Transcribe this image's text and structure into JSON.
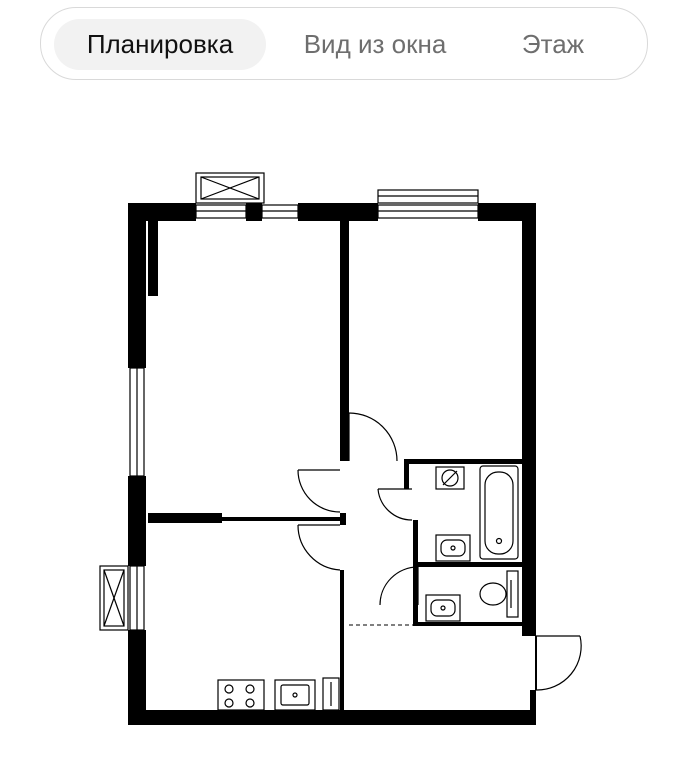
{
  "tabs": [
    {
      "label": "Планировка",
      "active": true
    },
    {
      "label": "Вид из окна",
      "active": false
    },
    {
      "label": "Этаж",
      "active": false
    }
  ],
  "colors": {
    "active_tab_bg": "#f2f2f2",
    "active_tab_text": "#111111",
    "inactive_tab_text": "#6e6e6e",
    "wall": "#000000"
  },
  "plan": {
    "icons": [
      "balcony-icon",
      "window-icon",
      "door-swing-icon",
      "bathtub-icon",
      "sink-icon",
      "toilet-icon",
      "stove-icon",
      "kitchen-sink-icon",
      "ventilation-icon"
    ]
  }
}
